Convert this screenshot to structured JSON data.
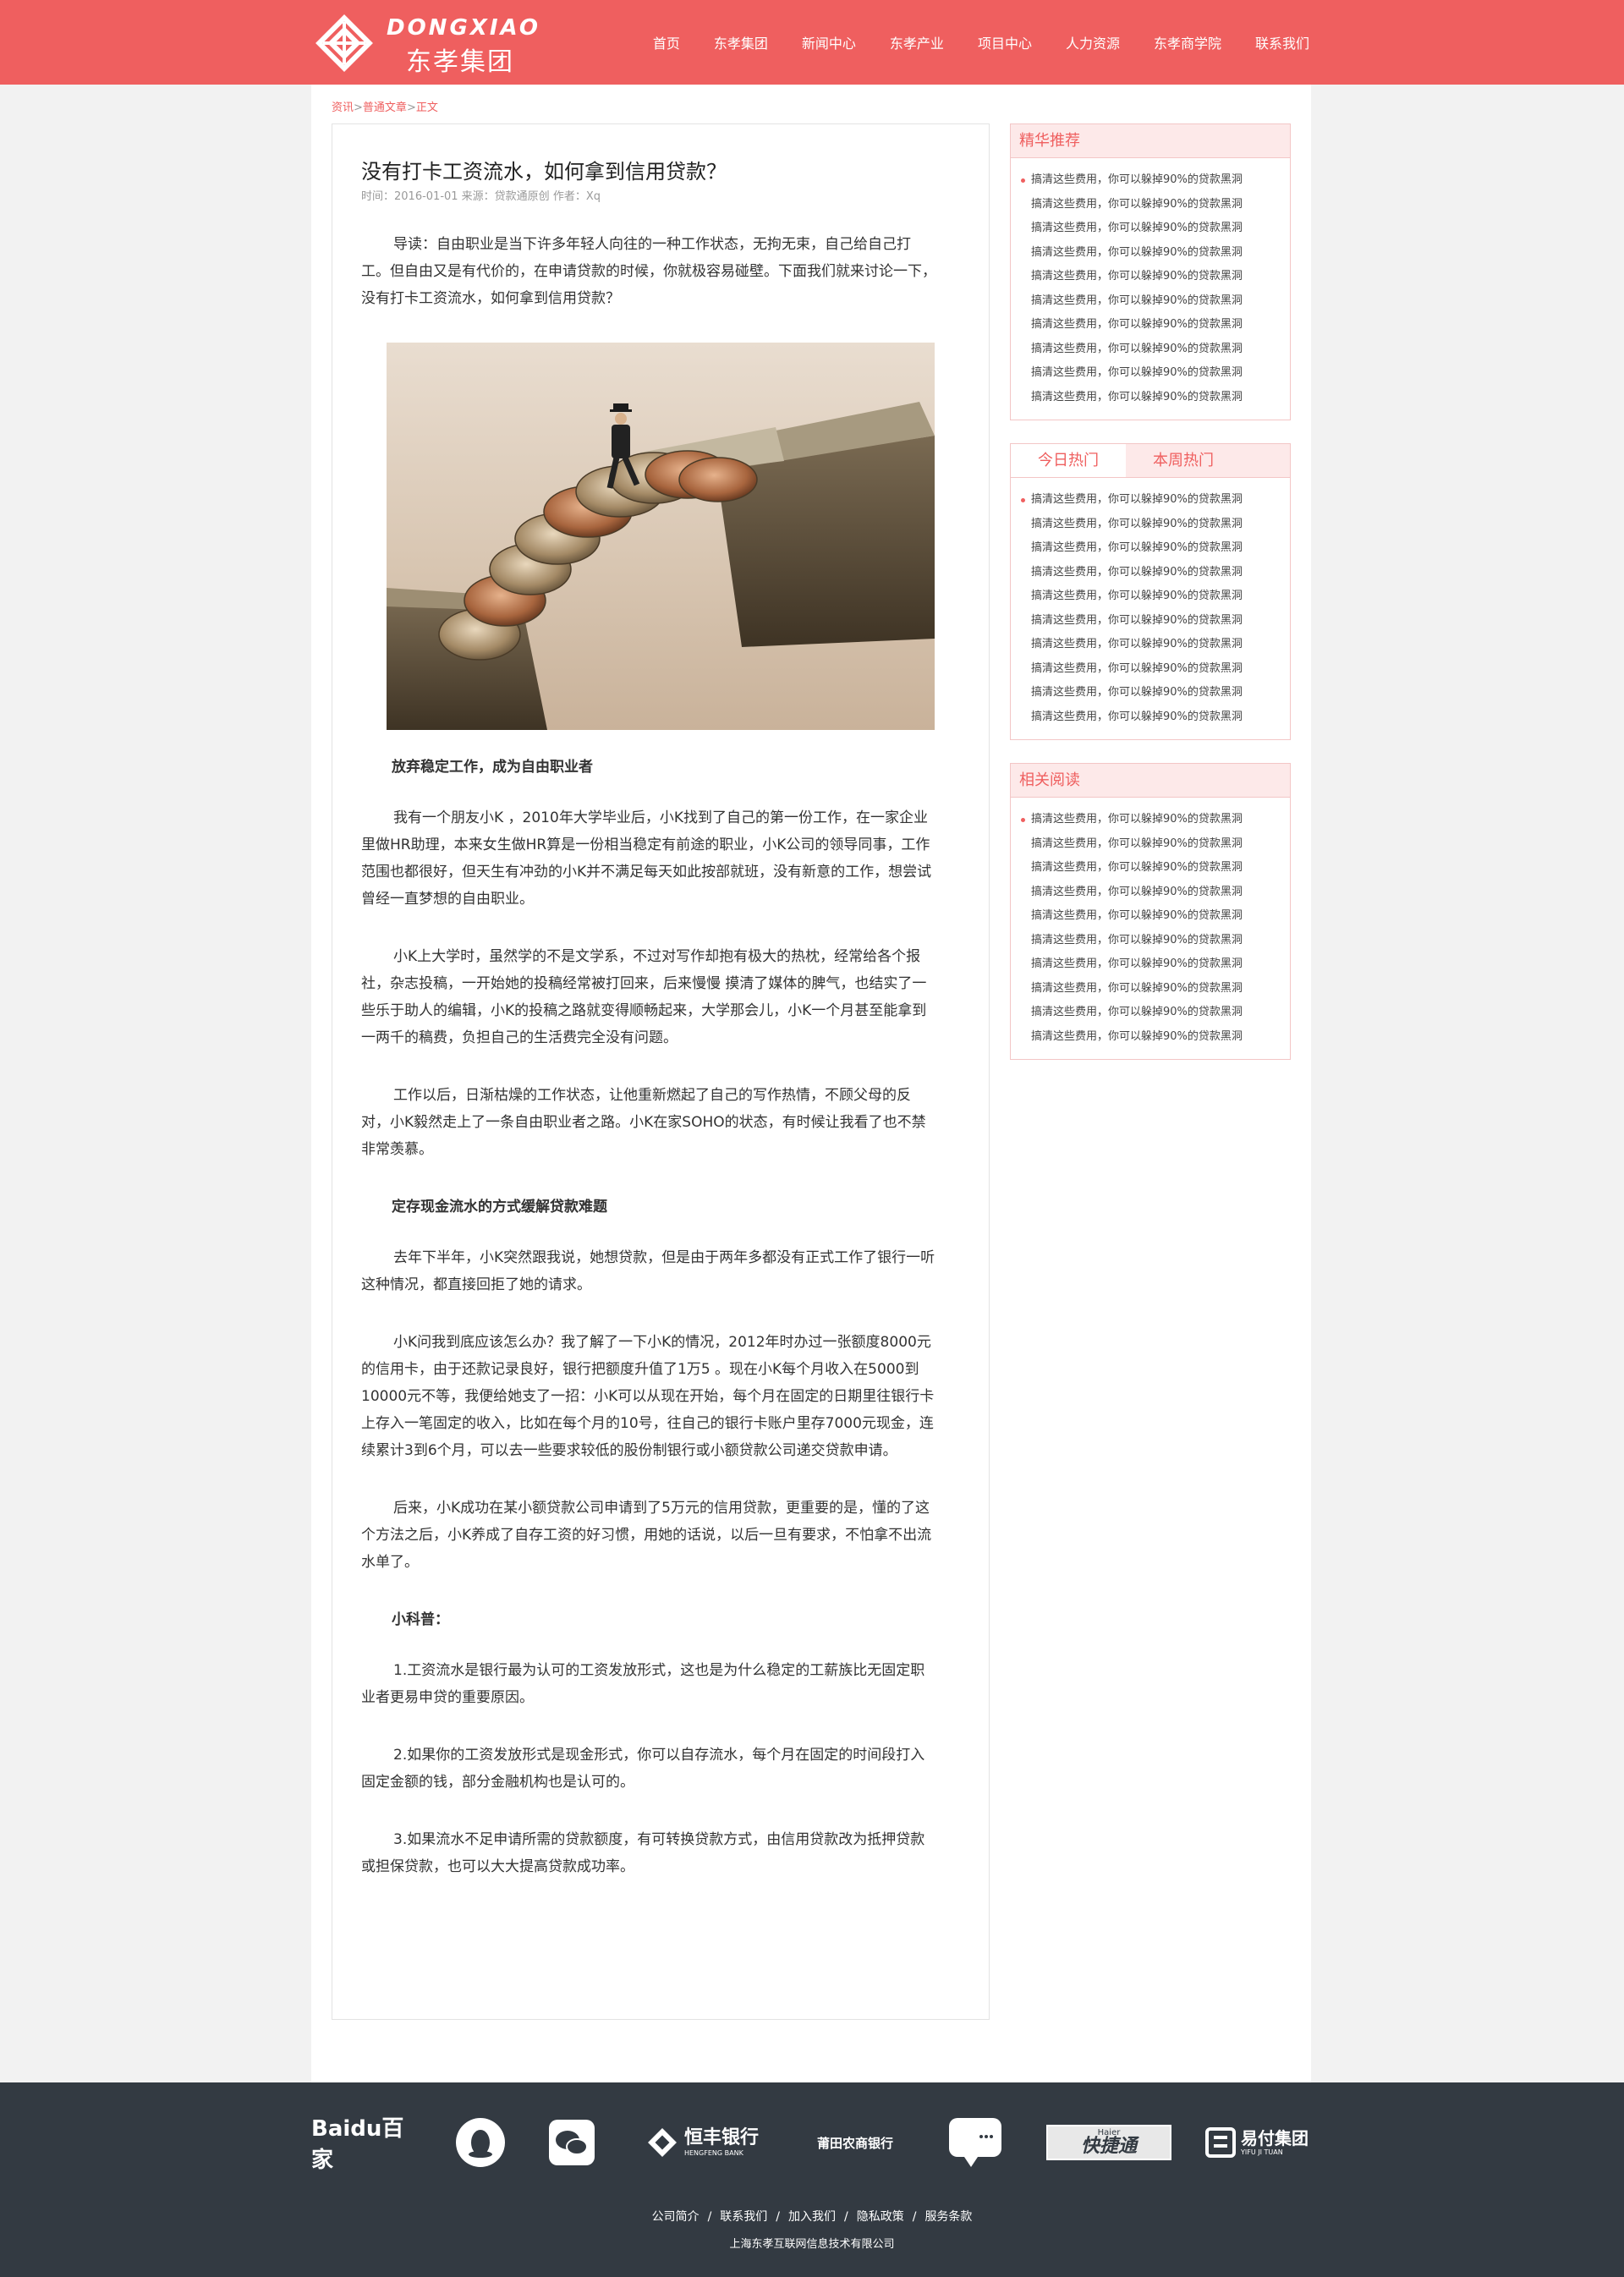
{
  "header": {
    "logo_en": "DONGXIAO",
    "logo_cn": "东孝集团",
    "nav": [
      "首页",
      "东孝集团",
      "新闻中心",
      "东孝产业",
      "项目中心",
      "人力资源",
      "东孝商学院",
      "联系我们"
    ]
  },
  "breadcrumb": {
    "items": [
      "资讯",
      "普通文章",
      "正文"
    ],
    "separator": ">"
  },
  "article": {
    "title": "没有打卡工资流水，如何拿到信用贷款？",
    "meta": "时间：2016-01-01 来源：贷款通原创 作者：Xq",
    "intro": "导读：自由职业是当下许多年轻人向往的一种工作状态，无拘无束，自己给自己打工。但自由又是有代价的，在申请贷款的时候，你就极容易碰壁。下面我们就来讨论一下，没有打卡工资流水，如何拿到信用贷款？",
    "subtitle1": "放弃稳定工作，成为自由职业者",
    "p1": "我有一个朋友小K ，2010年大学毕业后，小K找到了自己的第一份工作，在一家企业里做HR助理，本来女生做HR算是一份相当稳定有前途的职业，小K公司的领导同事，工作范围也都很好，但天生有冲劲的小K并不满足每天如此按部就班，没有新意的工作，想尝试曾经一直梦想的自由职业。",
    "p2": "小K上大学时，虽然学的不是文学系，不过对写作却抱有极大的热枕，经常给各个报社，杂志投稿，一开始她的投稿经常被打回来，后来慢慢 摸清了媒体的脾气，也结实了一些乐于助人的编辑，小K的投稿之路就变得顺畅起来，大学那会儿，小K一个月甚至能拿到一两千的稿费，负担自己的生活费完全没有问题。",
    "p3": "工作以后，日渐枯燥的工作状态，让他重新燃起了自己的写作热情，不顾父母的反对，小K毅然走上了一条自由职业者之路。小K在家SOHO的状态，有时候让我看了也不禁非常羡慕。",
    "subtitle2": "定存现金流水的方式缓解贷款难题",
    "p4": "去年下半年，小K突然跟我说，她想贷款，但是由于两年多都没有正式工作了银行一听这种情况，都直接回拒了她的请求。",
    "p5": "小K问我到底应该怎么办？我了解了一下小K的情况，2012年时办过一张额度8000元的信用卡，由于还款记录良好，银行把额度升值了1万5 。现在小K每个月收入在5000到10000元不等，我便给她支了一招：小K可以从现在开始，每个月在固定的日期里往银行卡上存入一笔固定的收入，比如在每个月的10号，往自己的银行卡账户里存7000元现金，连续累计3到6个月，可以去一些要求较低的股份制银行或小额贷款公司递交贷款申请。",
    "p6": "后来，小K成功在某小额贷款公司申请到了5万元的信用贷款，更重要的是，懂的了这个方法之后，小K养成了自存工资的好习惯，用她的话说，以后一旦有要求，不怕拿不出流水单了。",
    "subtitle3": "小科普：",
    "p7": "1.工资流水是银行最为认可的工资发放形式，这也是为什么稳定的工薪族比无固定职业者更易申贷的重要原因。",
    "p8": "2.如果你的工资发放形式是现金形式，你可以自存流水，每个月在固定的时间段打入固定金额的钱，部分金融机构也是认可的。",
    "p9": "3.如果流水不足申请所需的贷款额度，有可转换贷款方式，由信用贷款改为抵押贷款或担保贷款，也可以大大提高贷款成功率。"
  },
  "sidebar": {
    "recommend": {
      "title": "精华推荐",
      "items": [
        "搞清这些费用，你可以躲掉90%的贷款黑洞",
        "搞清这些费用，你可以躲掉90%的贷款黑洞",
        "搞清这些费用，你可以躲掉90%的贷款黑洞",
        "搞清这些费用，你可以躲掉90%的贷款黑洞",
        "搞清这些费用，你可以躲掉90%的贷款黑洞",
        "搞清这些费用，你可以躲掉90%的贷款黑洞",
        "搞清这些费用，你可以躲掉90%的贷款黑洞",
        "搞清这些费用，你可以躲掉90%的贷款黑洞",
        "搞清这些费用，你可以躲掉90%的贷款黑洞",
        "搞清这些费用，你可以躲掉90%的贷款黑洞"
      ]
    },
    "hot": {
      "tab_today": "今日热门",
      "tab_week": "本周热门",
      "items": [
        "搞清这些费用，你可以躲掉90%的贷款黑洞",
        "搞清这些费用，你可以躲掉90%的贷款黑洞",
        "搞清这些费用，你可以躲掉90%的贷款黑洞",
        "搞清这些费用，你可以躲掉90%的贷款黑洞",
        "搞清这些费用，你可以躲掉90%的贷款黑洞",
        "搞清这些费用，你可以躲掉90%的贷款黑洞",
        "搞清这些费用，你可以躲掉90%的贷款黑洞",
        "搞清这些费用，你可以躲掉90%的贷款黑洞",
        "搞清这些费用，你可以躲掉90%的贷款黑洞",
        "搞清这些费用，你可以躲掉90%的贷款黑洞"
      ]
    },
    "related": {
      "title": "相关阅读",
      "items": [
        "搞清这些费用，你可以躲掉90%的贷款黑洞",
        "搞清这些费用，你可以躲掉90%的贷款黑洞",
        "搞清这些费用，你可以躲掉90%的贷款黑洞",
        "搞清这些费用，你可以躲掉90%的贷款黑洞",
        "搞清这些费用，你可以躲掉90%的贷款黑洞",
        "搞清这些费用，你可以躲掉90%的贷款黑洞",
        "搞清这些费用，你可以躲掉90%的贷款黑洞",
        "搞清这些费用，你可以躲掉90%的贷款黑洞",
        "搞清这些费用，你可以躲掉90%的贷款黑洞",
        "搞清这些费用，你可以躲掉90%的贷款黑洞"
      ]
    }
  },
  "footer": {
    "partners": [
      {
        "name": "Baidu百家",
        "icon": "baidu-baijia-logo"
      },
      {
        "name": "",
        "icon": "qq-icon"
      },
      {
        "name": "",
        "icon": "wechat-icon"
      },
      {
        "name": "恒丰银行",
        "sub": "HENGFENG BANK",
        "icon": "hengfeng-bank-logo"
      },
      {
        "name": "莆田农商银行",
        "icon": "putian-bank-logo"
      },
      {
        "name": "",
        "icon": "sina-weibo-icon"
      },
      {
        "name": "快捷通",
        "sub": "Haier",
        "icon": "haier-kuaijietong-logo"
      },
      {
        "name": "易付集团",
        "sub": "YIFU JI TUAN",
        "icon": "yifu-group-logo"
      }
    ],
    "links": [
      "公司简介",
      "联系我们",
      "加入我们",
      "隐私政策",
      "服务条款"
    ],
    "copyright": "上海东孝互联网信息技术有限公司"
  },
  "colors": {
    "brand": "#ef5f5f",
    "footer_bg": "#333a42",
    "sidebar_head_bg": "#fde9e9"
  }
}
